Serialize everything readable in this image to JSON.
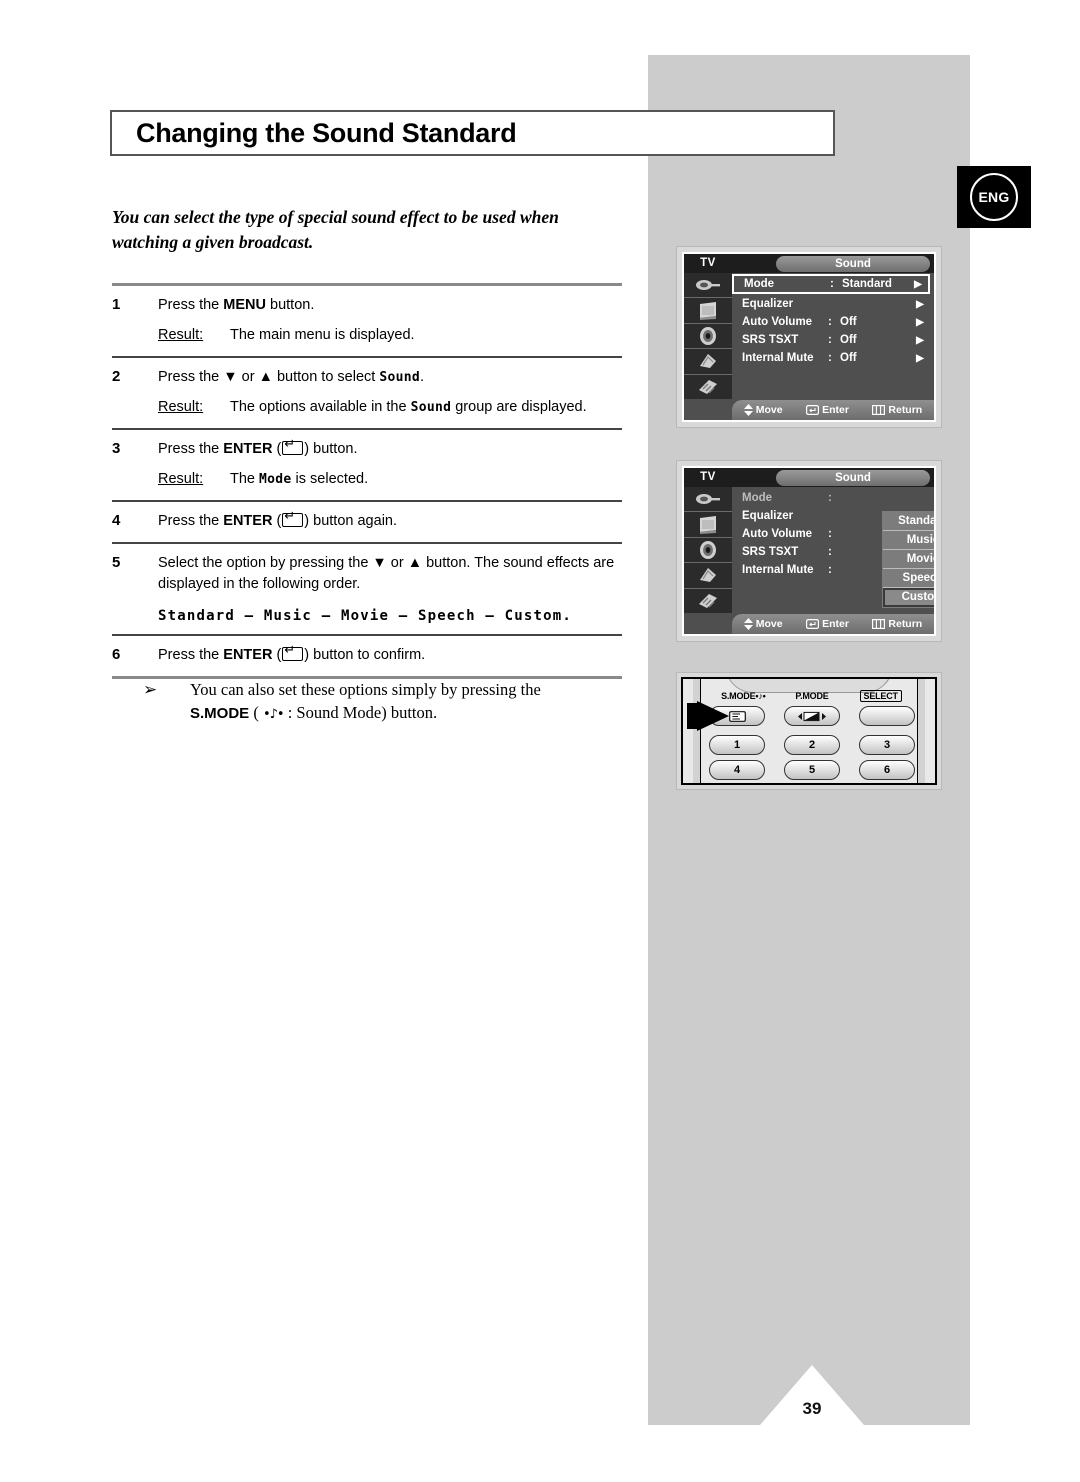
{
  "page": {
    "number": "39",
    "language_badge": "ENG",
    "title": "Changing the Sound Standard"
  },
  "intro": "You can select the type of special sound effect to be used when watching a given broadcast.",
  "steps": [
    {
      "num": "1",
      "text_pre": "Press the ",
      "bold": "MENU",
      "text_post": " button.",
      "result_label": "Result:",
      "result_text": "The main menu is displayed."
    },
    {
      "num": "2",
      "text_pre": "Press the ▼ or ▲ button to select ",
      "mono": "Sound",
      "text_post": ".",
      "result_label": "Result:",
      "result_pre": "The options available in the ",
      "result_mono": "Sound",
      "result_post": " group are displayed."
    },
    {
      "num": "3",
      "text_pre": "Press the ",
      "bold": "ENTER",
      "text_mid": " (",
      "icon": "enter-key-icon",
      "text_post": ") button.",
      "result_label": "Result:",
      "result_pre": "The ",
      "result_mono": "Mode",
      "result_post": " is selected."
    },
    {
      "num": "4",
      "text_pre": "Press the ",
      "bold": "ENTER",
      "text_mid": " (",
      "icon": "enter-key-icon",
      "text_post": ") button again."
    },
    {
      "num": "5",
      "text_pre": "Select the option by pressing the ▼ or ▲ button. The sound effects are displayed in the following order.",
      "order": "Standard – Music – Movie – Speech – Custom."
    },
    {
      "num": "6",
      "text_pre": "Press the ",
      "bold": "ENTER",
      "text_mid": " (",
      "icon": "enter-key-icon",
      "text_post": ") button to confirm."
    }
  ],
  "note": {
    "arrow": "➢",
    "line1": "You can also set these options simply by pressing the",
    "bold": "S.MODE",
    "paren_open": " ( ",
    "symbol": "•♪•",
    "paren_rest": " : Sound Mode) button."
  },
  "osd1": {
    "source_label": "TV",
    "title": "Sound",
    "rows": [
      {
        "label": "Mode",
        "colon": ":",
        "value": "Standard",
        "arrow": "▶",
        "selected": true
      },
      {
        "label": "Equalizer",
        "colon": "",
        "value": "",
        "arrow": "▶",
        "selected": false
      },
      {
        "label": "Auto Volume",
        "colon": ":",
        "value": "Off",
        "arrow": "▶",
        "selected": false
      },
      {
        "label": "SRS TSXT",
        "colon": ":",
        "value": "Off",
        "arrow": "▶",
        "selected": false
      },
      {
        "label": "Internal Mute",
        "colon": ":",
        "value": "Off",
        "arrow": "▶",
        "selected": false
      }
    ],
    "bottom": {
      "move": "Move",
      "enter": "Enter",
      "return": "Return"
    }
  },
  "osd2": {
    "source_label": "TV",
    "title": "Sound",
    "rows": [
      {
        "label": "Mode",
        "colon": ":"
      },
      {
        "label": "Equalizer",
        "colon": ""
      },
      {
        "label": "Auto Volume",
        "colon": ":"
      },
      {
        "label": "SRS TSXT",
        "colon": ":"
      },
      {
        "label": "Internal Mute",
        "colon": ":"
      }
    ],
    "options": [
      {
        "label": "Standard",
        "selected": false
      },
      {
        "label": "Music",
        "selected": false
      },
      {
        "label": "Movie",
        "selected": false
      },
      {
        "label": "Speech",
        "selected": false
      },
      {
        "label": "Custom",
        "selected": true
      }
    ],
    "bottom": {
      "move": "Move",
      "enter": "Enter",
      "return": "Return"
    }
  },
  "remote": {
    "labels": [
      {
        "text": "S.MODE",
        "symbol": "•♪•",
        "boxed": false
      },
      {
        "text": "P.MODE",
        "symbol": "",
        "boxed": false
      },
      {
        "text": "SELECT",
        "symbol": "",
        "boxed": true
      }
    ],
    "numbers": [
      [
        "1",
        "2",
        "3"
      ],
      [
        "4",
        "5",
        "6"
      ]
    ]
  }
}
